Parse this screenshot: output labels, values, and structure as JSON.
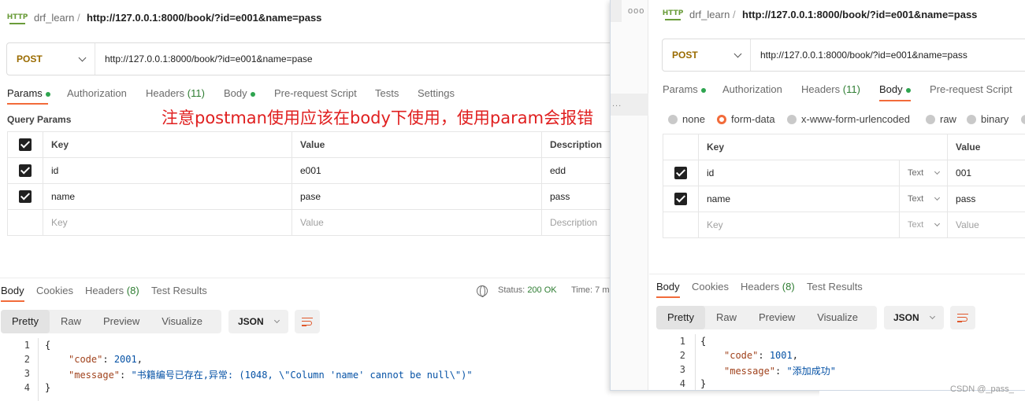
{
  "left": {
    "breadcrumb": {
      "icon_text": "HTTP",
      "collection": "drf_learn",
      "separator": "/",
      "request": "http://127.0.0.1:8000/book/?id=e001&name=pass"
    },
    "method": "POST",
    "url": "http://127.0.0.1:8000/book/?id=e001&name=pase",
    "tabs": [
      {
        "label": "Params",
        "dot": true
      },
      {
        "label": "Authorization"
      },
      {
        "label": "Headers",
        "count": "(11)"
      },
      {
        "label": "Body",
        "dot": true
      },
      {
        "label": "Pre-request Script"
      },
      {
        "label": "Tests"
      },
      {
        "label": "Settings"
      }
    ],
    "section_label": "Query Params",
    "annotation": "注意postman使用应该在body下使用，使用param会报错",
    "table": {
      "headers": [
        "Key",
        "Value",
        "Description"
      ],
      "rows": [
        {
          "key": "id",
          "value": "e001",
          "description": "edd"
        },
        {
          "key": "name",
          "value": "pase",
          "description": "pass"
        }
      ],
      "placeholder": {
        "key": "Key",
        "value": "Value",
        "description": "Description"
      }
    },
    "response_tabs": [
      {
        "label": "Body"
      },
      {
        "label": "Cookies"
      },
      {
        "label": "Headers",
        "count": "(8)"
      },
      {
        "label": "Test Results"
      }
    ],
    "status": {
      "label": "Status:",
      "value": "200 OK",
      "time_label": "Time: 7 m"
    },
    "view_modes": [
      "Pretty",
      "Raw",
      "Preview",
      "Visualize"
    ],
    "format": "JSON",
    "code_lines": {
      "l1": "{",
      "code_key": "\"code\"",
      "code_val": "2001",
      "msg_key": "\"message\"",
      "msg_val": "\"书籍编号已存在,异常: (1048, \\\"Column 'name' cannot be null\\\")\"",
      "l4": "}"
    }
  },
  "right": {
    "dots": "ooo",
    "side_text": "...",
    "breadcrumb": {
      "icon_text": "HTTP",
      "collection": "drf_learn",
      "separator": "/",
      "request": "http://127.0.0.1:8000/book/?id=e001&name=pass"
    },
    "method": "POST",
    "url": "http://127.0.0.1:8000/book/?id=e001&name=pass",
    "tabs": [
      {
        "label": "Params",
        "dot": true
      },
      {
        "label": "Authorization"
      },
      {
        "label": "Headers",
        "count": "(11)"
      },
      {
        "label": "Body",
        "dot": true
      },
      {
        "label": "Pre-request Script"
      }
    ],
    "body_types": [
      "none",
      "form-data",
      "x-www-form-urlencoded",
      "raw",
      "binary"
    ],
    "selected_body_type": "form-data",
    "table": {
      "headers": [
        "Key",
        "Value"
      ],
      "rows": [
        {
          "key": "id",
          "type": "Text",
          "value": "001"
        },
        {
          "key": "name",
          "type": "Text",
          "value": "pass"
        }
      ],
      "placeholder": {
        "key": "Key",
        "type": "Text",
        "value": "Value"
      }
    },
    "response_tabs": [
      {
        "label": "Body"
      },
      {
        "label": "Cookies"
      },
      {
        "label": "Headers",
        "count": "(8)"
      },
      {
        "label": "Test Results"
      }
    ],
    "view_modes": [
      "Pretty",
      "Raw",
      "Preview",
      "Visualize"
    ],
    "format": "JSON",
    "code_lines": {
      "l1": "{",
      "code_key": "\"code\"",
      "code_val": "1001",
      "msg_key": "\"message\"",
      "msg_val": "\"添加成功\"",
      "l4": "}"
    }
  },
  "watermark": "CSDN @_pass_",
  "colors": {
    "accent": "#f26b3a",
    "post_method": "#9a6b00",
    "status_ok": "#2e7d32",
    "annotation": "#e02020",
    "json_key": "#a0421c",
    "json_value": "#0451a5"
  }
}
